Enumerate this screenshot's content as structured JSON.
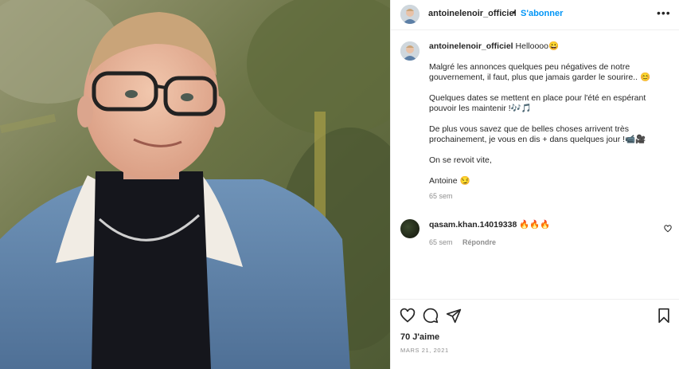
{
  "post": {
    "author": "antoinelenoir_officiel",
    "follow_label": "S'abonner",
    "header_dot": "•",
    "more_label": "•••"
  },
  "caption": {
    "author": "antoinelenoir_officiel",
    "lines": [
      "Helloooo😀⠀",
      "⠀",
      "Malgré les annonces quelques peu négatives de notre gouvernement, il faut, plus que jamais garder le sourire.. 😊 ⠀",
      "⠀",
      "Quelques dates se mettent en place pour l'été en espérant pouvoir les maintenir !🎶🎵⠀",
      "⠀",
      "De plus vous savez que de belles choses arrivent très prochainement, je vous en dis + dans quelques jour !📹🎥⠀",
      "⠀",
      "On se revoit vite,⠀",
      "⠀",
      "Antoine 😏"
    ],
    "time": "65 sem"
  },
  "comment": {
    "author": "qasam.khan.14019338",
    "text": "🔥🔥🔥",
    "time": "65 sem",
    "reply_label": "Répondre"
  },
  "footer": {
    "likes": "70 J'aime",
    "date": "MARS 21, 2021"
  },
  "icons": [
    "heart-icon",
    "comment-icon",
    "share-icon",
    "bookmark-icon",
    "more-icon"
  ],
  "colors": {
    "link": "#0095f6",
    "text": "#262626",
    "muted": "#8e8e8e",
    "border": "#efefef"
  }
}
